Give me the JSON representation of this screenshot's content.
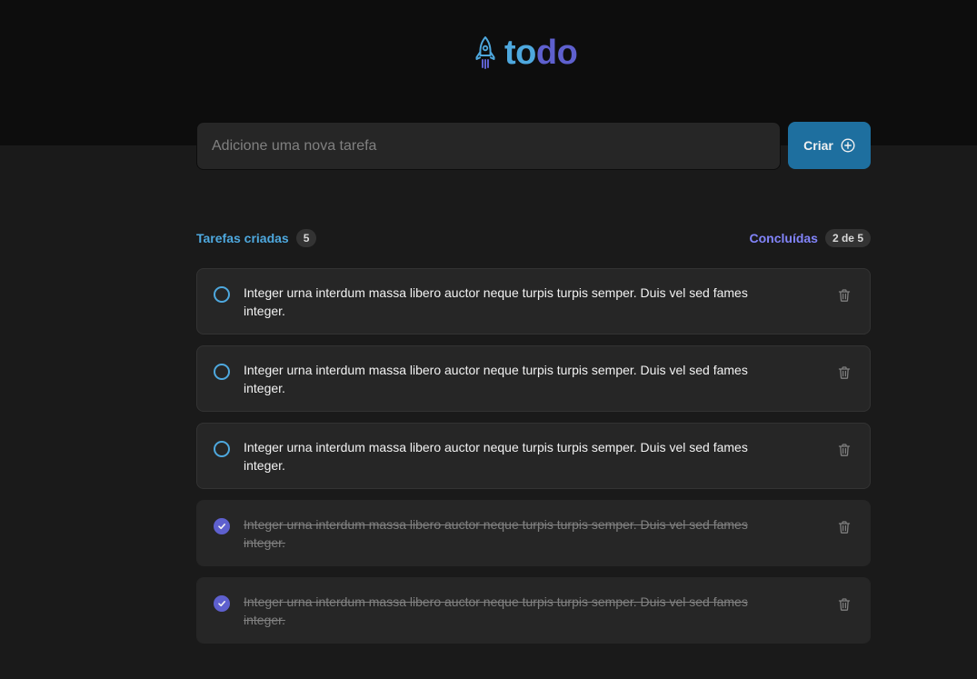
{
  "app": {
    "logo_part1": "to",
    "logo_part2": "do"
  },
  "new_task": {
    "placeholder": "Adicione uma nova tarefa",
    "value": "",
    "create_label": "Criar"
  },
  "summary": {
    "created_label": "Tarefas criadas",
    "created_count": "5",
    "done_label": "Concluídas",
    "done_count": "2 de 5"
  },
  "tasks": [
    {
      "text": "Integer urna interdum massa libero auctor neque turpis turpis semper. Duis vel sed fames integer.",
      "done": false
    },
    {
      "text": "Integer urna interdum massa libero auctor neque turpis turpis semper. Duis vel sed fames integer.",
      "done": false
    },
    {
      "text": "Integer urna interdum massa libero auctor neque turpis turpis semper. Duis vel sed fames integer.",
      "done": false
    },
    {
      "text": "Integer urna interdum massa libero auctor neque turpis turpis semper. Duis vel sed fames integer.",
      "done": true
    },
    {
      "text": "Integer urna interdum massa libero auctor neque turpis turpis semper. Duis vel sed fames integer.",
      "done": true
    }
  ],
  "icons": {
    "logo": "rocket-icon",
    "create": "plus-circle-icon",
    "check": "check-icon",
    "delete": "trash-icon"
  },
  "colors": {
    "blue": "#4ea8de",
    "blue_dark": "#1e6f9f",
    "purple": "#5e60ce",
    "purple_light": "#8284fa",
    "background": "#1a1a1a",
    "header": "#0d0d0d",
    "card": "#262626"
  }
}
